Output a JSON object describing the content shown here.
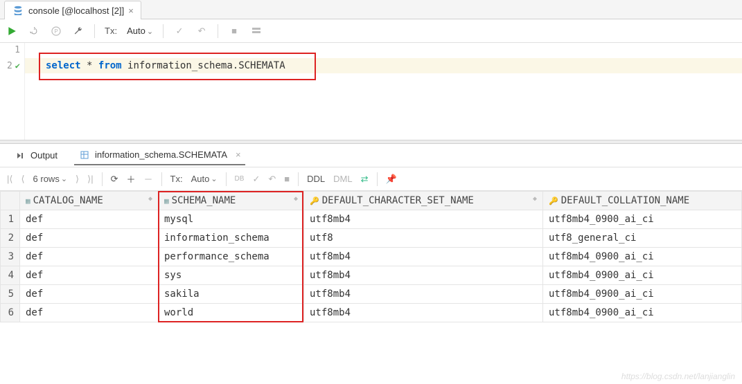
{
  "tab": {
    "title": "console [@localhost [2]]"
  },
  "editor_toolbar": {
    "tx_label": "Tx:",
    "tx_mode": "Auto"
  },
  "editor": {
    "lines": [
      "",
      "select * from information_schema.SCHEMATA"
    ],
    "sql_keywords": [
      "select",
      "from"
    ],
    "highlight_line_index": 1
  },
  "result_tabs": {
    "output": "Output",
    "schemata": "information_schema.SCHEMATA"
  },
  "result_toolbar": {
    "rows_label": "6 rows",
    "tx_label": "Tx:",
    "tx_mode": "Auto",
    "db_label": "DB",
    "ddl": "DDL",
    "dml": "DML"
  },
  "grid": {
    "columns": [
      "CATALOG_NAME",
      "SCHEMA_NAME",
      "DEFAULT_CHARACTER_SET_NAME",
      "DEFAULT_COLLATION_NAME"
    ],
    "rows": [
      {
        "n": "1",
        "c0": "def",
        "c1": "mysql",
        "c2": "utf8mb4",
        "c3": "utf8mb4_0900_ai_ci"
      },
      {
        "n": "2",
        "c0": "def",
        "c1": "information_schema",
        "c2": "utf8",
        "c3": "utf8_general_ci"
      },
      {
        "n": "3",
        "c0": "def",
        "c1": "performance_schema",
        "c2": "utf8mb4",
        "c3": "utf8mb4_0900_ai_ci"
      },
      {
        "n": "4",
        "c0": "def",
        "c1": "sys",
        "c2": "utf8mb4",
        "c3": "utf8mb4_0900_ai_ci"
      },
      {
        "n": "5",
        "c0": "def",
        "c1": "sakila",
        "c2": "utf8mb4",
        "c3": "utf8mb4_0900_ai_ci"
      },
      {
        "n": "6",
        "c0": "def",
        "c1": "world",
        "c2": "utf8mb4",
        "c3": "utf8mb4_0900_ai_ci"
      }
    ]
  },
  "watermark": "https://blog.csdn.net/lanjianglin"
}
